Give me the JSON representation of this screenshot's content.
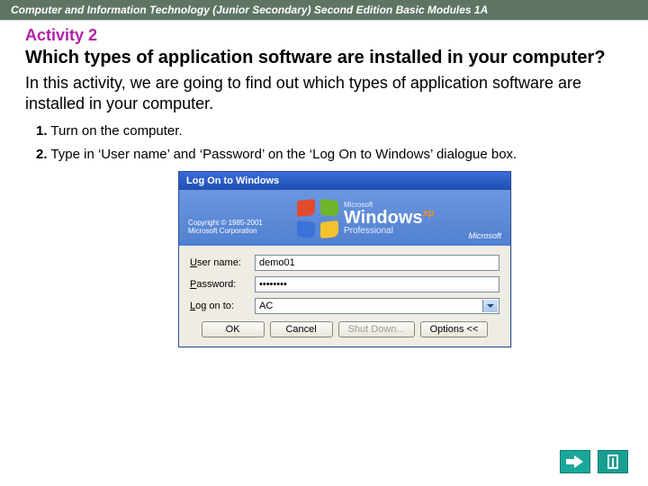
{
  "header": "Computer and Information Technology (Junior Secondary) Second Edition Basic Modules 1A",
  "activity_label": "Activity 2",
  "activity_question": "Which types of application software are installed in your computer?",
  "intro": "In this activity, we are going to find out which types of application software are installed in your computer.",
  "steps": {
    "s1_num": "1.",
    "s1_text": "Turn on the computer.",
    "s2_num": "2.",
    "s2_text": "Type in ‘User name’ and ‘Password’ on the ‘Log On to Windows’ dialogue box."
  },
  "dialog": {
    "title": "Log On to Windows",
    "copyright": "Copyright © 1985-2001",
    "corp": "Microsoft Corporation",
    "ms_small": "Microsoft",
    "windows": "Windows",
    "xp": "xp",
    "prof": "Professional",
    "ms_right": "Microsoft",
    "labels": {
      "user": "User name:",
      "pass": "Password:",
      "logon": "Log on to:"
    },
    "values": {
      "user": "demo01",
      "pass": "••••••••",
      "logon": "AC"
    },
    "buttons": {
      "ok": "OK",
      "cancel": "Cancel",
      "shutdown": "Shut Down...",
      "options": "Options <<"
    }
  }
}
